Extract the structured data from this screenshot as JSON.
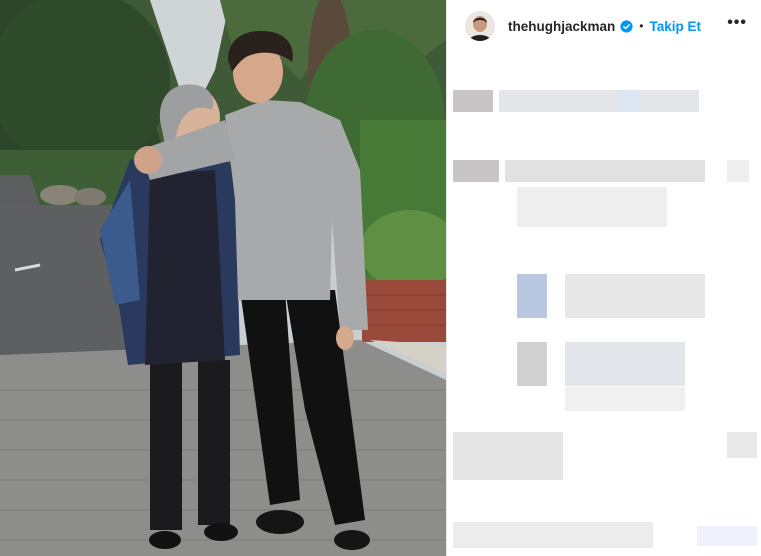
{
  "post": {
    "username": "thehughjackman",
    "separator": "•",
    "follow_label": "Takip Et",
    "more_label": "•••"
  },
  "icons": {
    "verified": "verified-badge-icon",
    "more": "more-options-icon",
    "avatar": "profile-avatar"
  },
  "colors": {
    "follow": "#0095f6",
    "verified": "#0095f6",
    "username": "#262626"
  }
}
